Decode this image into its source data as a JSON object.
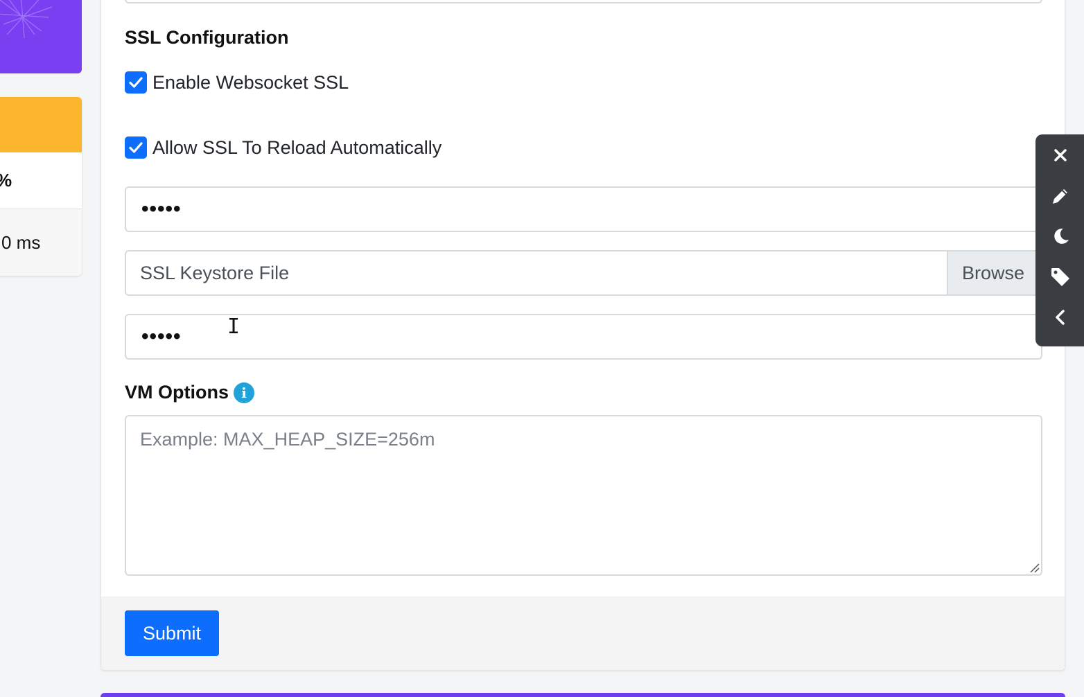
{
  "left_cards": {
    "stat_percent_suffix": "%",
    "stat_time_text": "0 ms",
    "colors": {
      "purple": "#7b3ff2",
      "orange": "#fdb52e"
    }
  },
  "ssl": {
    "section_title": "SSL Configuration",
    "enable_websocket_ssl": {
      "label": "Enable Websocket SSL",
      "checked": true
    },
    "allow_reload": {
      "label": "Allow SSL To Reload Automatically",
      "checked": true
    },
    "password_1_value": "•••••",
    "keystore_file": {
      "placeholder": "SSL Keystore File",
      "browse_label": "Browse"
    },
    "password_2_value": "•••••"
  },
  "vm_options": {
    "label": "VM Options",
    "info_icon": "info-icon",
    "placeholder": "Example: MAX_HEAP_SIZE=256m"
  },
  "footer": {
    "submit_label": "Submit"
  },
  "toolbar": {
    "icons": [
      "close-icon",
      "pencil-icon",
      "moon-icon",
      "tag-icon",
      "chevron-left-icon"
    ]
  },
  "theme": {
    "accent": "#0d6efd",
    "info": "#1fa3d8",
    "toolbar_bg": "#3a3d41"
  }
}
